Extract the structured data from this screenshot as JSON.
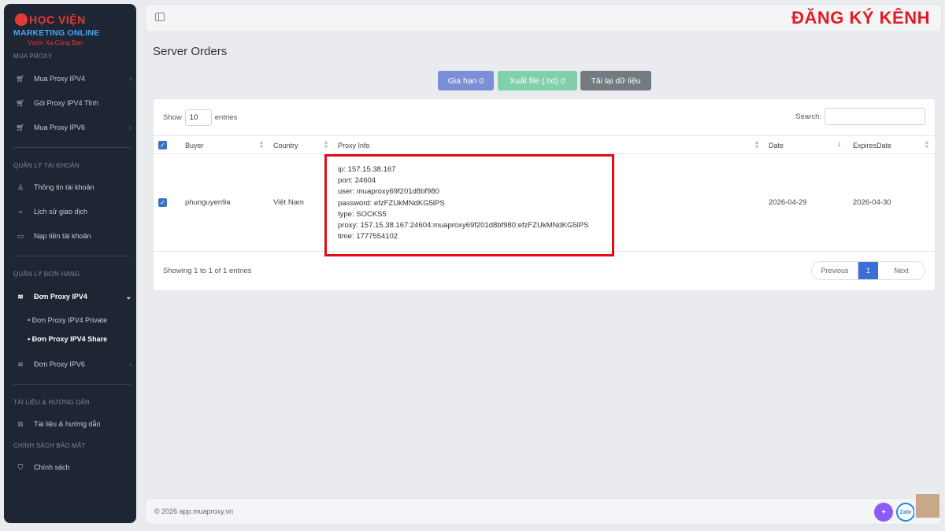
{
  "logo": {
    "line1": "HỌC VIỆN",
    "line2": "MARKETING ONLINE",
    "line3": "Vươn Xa Cùng Bạn"
  },
  "sidebar": {
    "sections": [
      {
        "title": "MUA PROXY"
      },
      {
        "title": "QUẢN LÝ TÀI KHOẢN"
      },
      {
        "title": "QUẢN LÝ ĐƠN HÀNG"
      },
      {
        "title": "TÀI LIỆU & HƯỚNG DẪN"
      },
      {
        "title": "CHÍNH SÁCH BẢO MẬT"
      }
    ],
    "items": [
      {
        "label": "Mua Proxy IPV4",
        "icon": "cart-icon"
      },
      {
        "label": "Gói Proxy IPV4 Tĩnh",
        "icon": "cart-icon"
      },
      {
        "label": "Mua Proxy IPV6",
        "icon": "cart-icon"
      },
      {
        "label": "Thông tin tài khoản",
        "icon": "user-icon"
      },
      {
        "label": "Lịch sử giao dịch",
        "icon": "activity-icon"
      },
      {
        "label": "Nạp tiền tài khoản",
        "icon": "card-icon"
      },
      {
        "label": "Đơn Proxy IPV4",
        "icon": "wifi-icon"
      },
      {
        "label": "Đơn Proxy IPV6",
        "icon": "wifi-icon"
      },
      {
        "label": "Tài liệu & hướng dẫn",
        "icon": "doc-icon"
      },
      {
        "label": "Chính sách",
        "icon": "shield-icon"
      }
    ],
    "subitems": [
      {
        "label": "Đơn Proxy IPV4 Private"
      },
      {
        "label": "Đơn Proxy IPV4 Share"
      }
    ]
  },
  "topbar": {
    "brand": "ĐĂNG KÝ KÊNH"
  },
  "page": {
    "title": "Server Orders"
  },
  "actions": {
    "renew": "Gia hạn 0",
    "export": "Xuất file (.txt) 0",
    "reload": "Tải lại dữ liệu"
  },
  "table": {
    "show_label": "Show",
    "show_value": "10",
    "entries_label": "entries",
    "search_label": "Search:",
    "headers": {
      "buyer": "Buyer",
      "country": "Country",
      "proxy_info": "Proxy Info",
      "date": "Date",
      "expires": "ExpiresDate"
    },
    "rows": [
      {
        "buyer": "phunguyen9a",
        "country": "Việt Nam",
        "proxy_lines": [
          "ip: 157.15.38.167",
          "port: 24604",
          "user: muaproxy69f201d8bf980",
          "password: efzFZUkMNdKG5lPS",
          "type: SOCKS5",
          "proxy: 157.15.38.167:24604:muaproxy69f201d8bf980:efzFZUkMNdKG5lPS",
          "time: 1777554102"
        ],
        "date": "2026-04-29",
        "expires": "2026-04-30"
      }
    ],
    "info": "Showing 1 to 1 of 1 entries",
    "pager": {
      "prev": "Previous",
      "current": "1",
      "next": "Next"
    }
  },
  "footer": {
    "copyright": "© 2026 app.muaproxy.vn"
  },
  "widgets": {
    "zalo": "Zalo"
  },
  "colors": {
    "primary": "#3b6fd4",
    "highlight": "#e10b1c",
    "sidebar_bg": "#1f2633"
  }
}
